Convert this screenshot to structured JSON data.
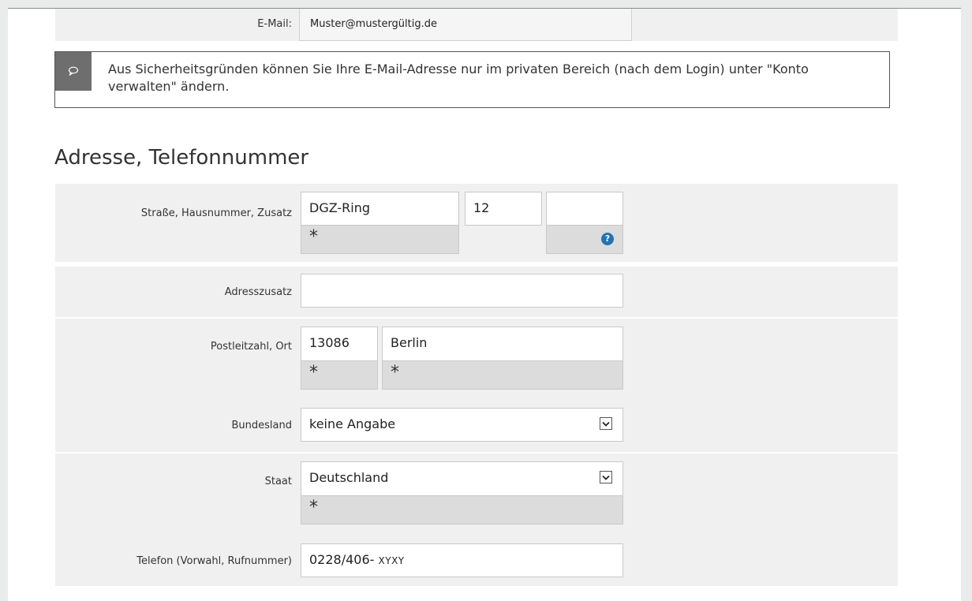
{
  "email": {
    "label": "E-Mail:",
    "value": "Muster@mustergültig.de"
  },
  "notice": {
    "icon": "speech-bubble-icon",
    "text": "Aus Sicherheitsgründen können Sie Ihre E-Mail-Adresse nur im privaten Bereich (nach dem Login) unter \"Konto verwalten\" ändern."
  },
  "section": {
    "title": "Adresse, Telefonnummer"
  },
  "street": {
    "label": "Straße,  Hausnummer,  Zusatz",
    "street_value": "DGZ-Ring",
    "number_value": "12",
    "suffix_value": "",
    "required_mark": "*"
  },
  "address_addition": {
    "label": "Adresszusatz",
    "value": ""
  },
  "postal": {
    "label": "Postleitzahl,  Ort",
    "zip_value": "13086",
    "city_value": "Berlin",
    "required_mark": "*"
  },
  "state": {
    "label": "Bundesland",
    "selected": "keine Angabe"
  },
  "country": {
    "label": "Staat",
    "selected": "Deutschland",
    "required_mark": "*"
  },
  "phone": {
    "label": "Telefon (Vorwahl, Rufnummer)",
    "value_prefix": "0228/406- ",
    "value_suffix": "XYXY"
  },
  "colors": {
    "help_icon": "#1f74b5",
    "row_background": "#f0f0f0",
    "required_background": "#dcdcdc"
  }
}
